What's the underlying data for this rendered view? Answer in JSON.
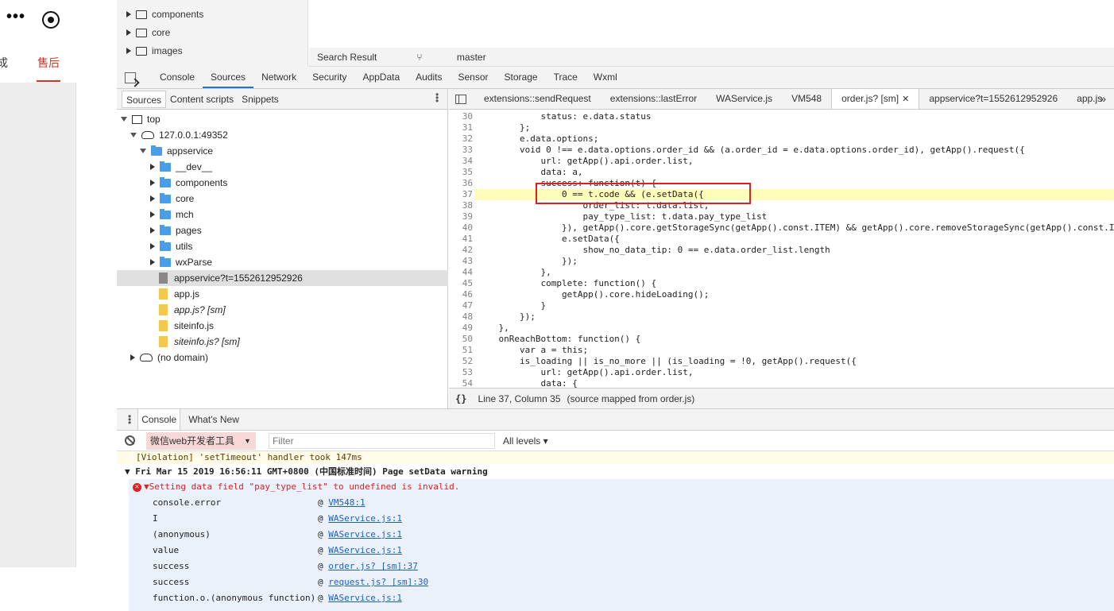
{
  "simulator": {
    "menu_dots": "•••",
    "left_char": "成",
    "tab_label": "售后"
  },
  "top_tree": {
    "items": [
      "components",
      "core",
      "images"
    ]
  },
  "top_bar": {
    "search_result": "Search Result",
    "branch": "master"
  },
  "devtools_tabs": [
    "Console",
    "Sources",
    "Network",
    "Security",
    "AppData",
    "Audits",
    "Sensor",
    "Storage",
    "Trace",
    "Wxml"
  ],
  "navigator": {
    "tabs": [
      "Sources",
      "Content scripts",
      "Snippets"
    ],
    "tree": {
      "top": "top",
      "host": "127.0.0.1:49352",
      "appservice": "appservice",
      "folders": [
        "__dev__",
        "components",
        "core",
        "mch",
        "pages",
        "utils",
        "wxParse"
      ],
      "files": [
        "appservice?t=1552612952926",
        "app.js",
        "app.js? [sm]",
        "siteinfo.js",
        "siteinfo.js? [sm]"
      ],
      "no_domain": "(no domain)"
    }
  },
  "editor_tabs": [
    "extensions::sendRequest",
    "extensions::lastError",
    "WAService.js",
    "VM548",
    "order.js? [sm]",
    "appservice?t=1552612952926",
    "app.js"
  ],
  "code_lines": [
    {
      "n": "30",
      "t": "            status: e.data.status"
    },
    {
      "n": "31",
      "t": "        };"
    },
    {
      "n": "32",
      "t": "        e.data.options;"
    },
    {
      "n": "33",
      "t": "        void 0 !== e.data.options.order_id && (a.order_id = e.data.options.order_id), getApp().request({"
    },
    {
      "n": "34",
      "t": "            url: getApp().api.order.list,"
    },
    {
      "n": "35",
      "t": "            data: a,"
    },
    {
      "n": "36",
      "t": "            success: function(t) {"
    },
    {
      "n": "37",
      "t": "                0 == t.code && (e.setData({"
    },
    {
      "n": "38",
      "t": "                    order_list: t.data.list,"
    },
    {
      "n": "39",
      "t": "                    pay_type_list: t.data.pay_type_list"
    },
    {
      "n": "40",
      "t": "                }), getApp().core.getStorageSync(getApp().const.ITEM) && getApp().core.removeStorageSync(getApp().const.ITEM"
    },
    {
      "n": "41",
      "t": "                e.setData({"
    },
    {
      "n": "42",
      "t": "                    show_no_data_tip: 0 == e.data.order_list.length"
    },
    {
      "n": "43",
      "t": "                });"
    },
    {
      "n": "44",
      "t": "            },"
    },
    {
      "n": "45",
      "t": "            complete: function() {"
    },
    {
      "n": "46",
      "t": "                getApp().core.hideLoading();"
    },
    {
      "n": "47",
      "t": "            }"
    },
    {
      "n": "48",
      "t": "        });"
    },
    {
      "n": "49",
      "t": "    },"
    },
    {
      "n": "50",
      "t": "    onReachBottom: function() {"
    },
    {
      "n": "51",
      "t": "        var a = this;"
    },
    {
      "n": "52",
      "t": "        is_loading || is_no_more || (is_loading = !0, getApp().request({"
    },
    {
      "n": "53",
      "t": "            url: getApp().api.order.list,"
    },
    {
      "n": "54",
      "t": "            data: {"
    }
  ],
  "highlighted_line": "37",
  "status_bar": {
    "braces": "{}",
    "position": "Line 37, Column 35",
    "source_mapped": "(source mapped from order.js)"
  },
  "drawer_tabs": [
    "Console",
    "What's New"
  ],
  "console_toolbar": {
    "context": "微信web开发者工具",
    "filter_placeholder": "Filter",
    "levels": "All levels"
  },
  "console": {
    "violation": "[Violation] 'setTimeout' handler took 147ms",
    "group_header": "Fri Mar 15 2019 16:56:11 GMT+0800 (中国标准时间) Page setData warning",
    "error": "Setting data field \"pay_type_list\" to undefined is invalid.",
    "stack": [
      {
        "fn": "console.error",
        "loc": "VM548:1"
      },
      {
        "fn": "I",
        "loc": "WAService.js:1"
      },
      {
        "fn": "(anonymous)",
        "loc": "WAService.js:1"
      },
      {
        "fn": "value",
        "loc": "WAService.js:1"
      },
      {
        "fn": "success",
        "loc": "order.js? [sm]:37"
      },
      {
        "fn": "success",
        "loc": "request.js? [sm]:30"
      },
      {
        "fn": "function.o.(anonymous function)",
        "loc": "WAService.js:1"
      }
    ]
  }
}
